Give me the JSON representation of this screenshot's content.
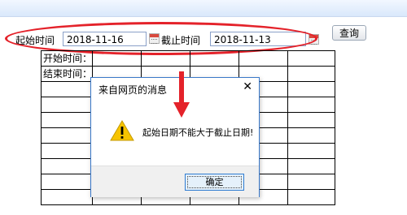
{
  "search": {
    "start_label": "起始时间",
    "start_value": "2018-11-16",
    "end_label": "截止时间",
    "end_value": "2018-11-13",
    "query_label": "查询"
  },
  "table": {
    "row_labels": [
      "开始时间：",
      "结束时间："
    ]
  },
  "dialog": {
    "title": "来自网页的消息",
    "close": "✕",
    "message": "起始日期不能大于截止日期!",
    "ok_label": "确定"
  },
  "colors": {
    "annotation_red": "#e4222a",
    "dialog_border": "#3a78c8",
    "warning_yellow": "#f7c400"
  },
  "icons": [
    "calendar-icon",
    "warning-icon",
    "close-icon",
    "arrow-down-icon"
  ]
}
